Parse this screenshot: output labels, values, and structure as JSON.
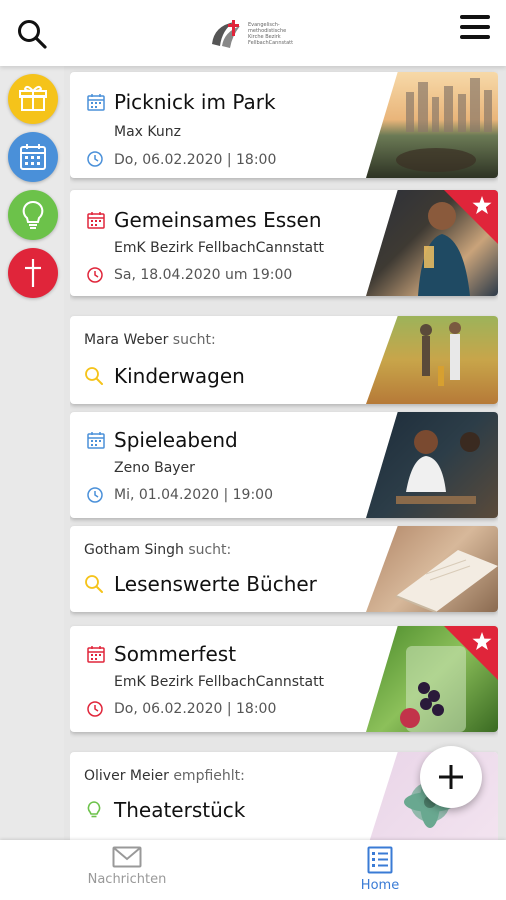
{
  "header": {
    "logo_text": "Evangelisch-methodistische Kirche Bezirk FellbachCannstatt"
  },
  "colors": {
    "accent_blue": "#3a7bd5",
    "accent_red": "#e0253a",
    "gift_yellow": "#f5c31a",
    "calendar_blue": "#4a90d9",
    "idea_green": "#6cc24a",
    "church_red": "#e0253a"
  },
  "side_icons": [
    "gift-icon",
    "calendar-icon",
    "lightbulb-icon",
    "cross-icon"
  ],
  "feed": [
    {
      "type": "event",
      "title": "Picknick im Park",
      "subtitle": "Max Kunz",
      "date": "Do, 06.02.2020 | 18:00",
      "color": "blue",
      "starred": false
    },
    {
      "type": "event",
      "title": "Gemeinsames Essen",
      "subtitle": "EmK Bezirk FellbachCannstatt",
      "date": "Sa, 18.04.2020 um 19:00",
      "color": "red",
      "starred": true
    },
    {
      "type": "search",
      "person": "Mara Weber",
      "verb": "sucht:",
      "item": "Kinderwagen"
    },
    {
      "type": "event",
      "title": "Spieleabend",
      "subtitle": "Zeno Bayer",
      "date": "Mi, 01.04.2020 | 19:00",
      "color": "blue",
      "starred": false
    },
    {
      "type": "search",
      "person": "Gotham Singh",
      "verb": "sucht:",
      "item": "Lesenswerte Bücher"
    },
    {
      "type": "event",
      "title": "Sommerfest",
      "subtitle": "EmK Bezirk FellbachCannstatt",
      "date": "Do, 06.02.2020 | 18:00",
      "color": "red",
      "starred": true
    },
    {
      "type": "recommend",
      "person": "Oliver Meier",
      "verb": "empfiehlt:",
      "item": "Theaterstück"
    }
  ],
  "bottom_nav": [
    {
      "label": "Nachrichten",
      "icon": "mail-icon",
      "active": false
    },
    {
      "label": "Home",
      "icon": "list-icon",
      "active": true
    }
  ]
}
